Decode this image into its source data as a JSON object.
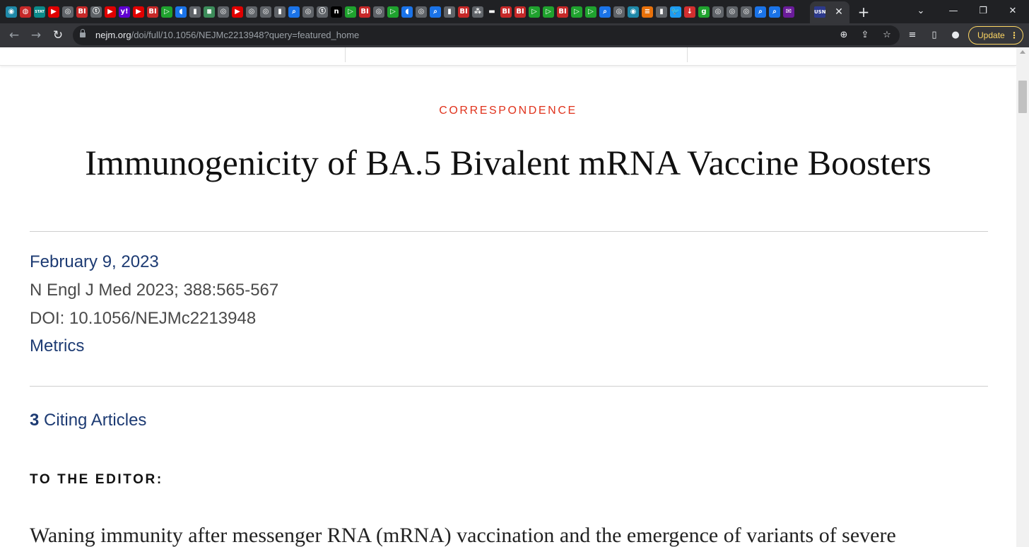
{
  "browser": {
    "tab_favicons": [
      {
        "glyph": "◉",
        "color": "#1e88a8"
      },
      {
        "glyph": "◍",
        "color": "#c62828"
      },
      {
        "glyph": "STAT",
        "color": "#0b8a8a"
      },
      {
        "glyph": "▶",
        "color": "#e00000"
      },
      {
        "glyph": "◎",
        "color": "#5f6368"
      },
      {
        "glyph": "BI",
        "color": "#c62828"
      },
      {
        "glyph": "ⓣ",
        "color": "#5f6368"
      },
      {
        "glyph": "▶",
        "color": "#e00000"
      },
      {
        "glyph": "y!",
        "color": "#6001d2"
      },
      {
        "glyph": "▶",
        "color": "#e00000"
      },
      {
        "glyph": "BI",
        "color": "#c62828"
      },
      {
        "glyph": "▷",
        "color": "#1fa22e"
      },
      {
        "glyph": "◖",
        "color": "#1a73e8"
      },
      {
        "glyph": "▮",
        "color": "#5f6368"
      },
      {
        "glyph": "⧆",
        "color": "#3c8c5a"
      },
      {
        "glyph": "◎",
        "color": "#5f6368"
      },
      {
        "glyph": "▶",
        "color": "#e00000"
      },
      {
        "glyph": "◎",
        "color": "#5f6368"
      },
      {
        "glyph": "◎",
        "color": "#5f6368"
      },
      {
        "glyph": "▮",
        "color": "#5f6368"
      },
      {
        "glyph": "⌕",
        "color": "#1a73e8"
      },
      {
        "glyph": "◎",
        "color": "#5f6368"
      },
      {
        "glyph": "ⓣ",
        "color": "#5f6368"
      },
      {
        "glyph": "n",
        "color": "#000000"
      },
      {
        "glyph": "▷",
        "color": "#1fa22e"
      },
      {
        "glyph": "BI",
        "color": "#c62828"
      },
      {
        "glyph": "◎",
        "color": "#5f6368"
      },
      {
        "glyph": "▷",
        "color": "#1fa22e"
      },
      {
        "glyph": "◖",
        "color": "#1a73e8"
      },
      {
        "glyph": "◎",
        "color": "#5f6368"
      },
      {
        "glyph": "⌕",
        "color": "#1a73e8"
      },
      {
        "glyph": "▮",
        "color": "#5f6368"
      },
      {
        "glyph": "BI",
        "color": "#c62828"
      },
      {
        "glyph": "⁂",
        "color": "#5f6368"
      },
      {
        "glyph": "▬",
        "color": "#202124"
      },
      {
        "glyph": "BI",
        "color": "#c62828"
      },
      {
        "glyph": "BI",
        "color": "#c62828"
      },
      {
        "glyph": "▷",
        "color": "#1fa22e"
      },
      {
        "glyph": "▷",
        "color": "#1fa22e"
      },
      {
        "glyph": "BI",
        "color": "#c62828"
      },
      {
        "glyph": "▷",
        "color": "#1fa22e"
      },
      {
        "glyph": "▷",
        "color": "#1fa22e"
      },
      {
        "glyph": "⌕",
        "color": "#1a73e8"
      },
      {
        "glyph": "◎",
        "color": "#5f6368"
      },
      {
        "glyph": "◉",
        "color": "#1e88a8"
      },
      {
        "glyph": "≡",
        "color": "#e8710a"
      },
      {
        "glyph": "▮",
        "color": "#5f6368"
      },
      {
        "glyph": "🐦",
        "color": "#1d9bf0"
      },
      {
        "glyph": "↓",
        "color": "#d32f2f"
      },
      {
        "glyph": "g",
        "color": "#1fa22e"
      },
      {
        "glyph": "◎",
        "color": "#5f6368"
      },
      {
        "glyph": "◎",
        "color": "#5f6368"
      },
      {
        "glyph": "◎",
        "color": "#5f6368"
      },
      {
        "glyph": "⌕",
        "color": "#1a73e8"
      },
      {
        "glyph": "⌕",
        "color": "#1a73e8"
      },
      {
        "glyph": "✉",
        "color": "#6a1b9a"
      }
    ],
    "active_tab_favicon": "USN",
    "active_tab_close": "✕",
    "new_tab": "+",
    "window_controls": {
      "list": "⌄",
      "minimize": "—",
      "restore": "❐",
      "close": "✕"
    },
    "nav": {
      "back": "←",
      "forward": "→",
      "reload": "↻"
    },
    "url_host": "nejm.org",
    "url_path": "/doi/full/10.1056/NEJMc2213948?query=featured_home",
    "omnibox_icons": {
      "zoom": "⊕",
      "share": "⇪",
      "bookmark": "☆"
    },
    "toolbar_icons": {
      "media": "≡",
      "sidepanel": "▯",
      "profile": "●"
    },
    "update_label": "Update",
    "update_menu": "⋮"
  },
  "article": {
    "section": "CORRESPONDENCE",
    "title": "Immunogenicity of BA.5 Bivalent mRNA Vaccine Boosters",
    "date": "February 9, 2023",
    "citation": "N Engl J Med 2023; 388:565-567",
    "doi": "DOI: 10.1056/NEJMc2213948",
    "metrics_label": "Metrics",
    "citing_count": "3",
    "citing_label": "Citing Articles",
    "editor_heading": "TO THE EDITOR:",
    "body_first_line": "Waning immunity after messenger RNA (mRNA) vaccination and the emergence of variants of severe"
  },
  "colors": {
    "kicker": "#e0321c",
    "link": "#1d3b73",
    "chrome_dark": "#202124",
    "chrome_toolbar": "#35363a",
    "update_accent": "#fdd663"
  }
}
